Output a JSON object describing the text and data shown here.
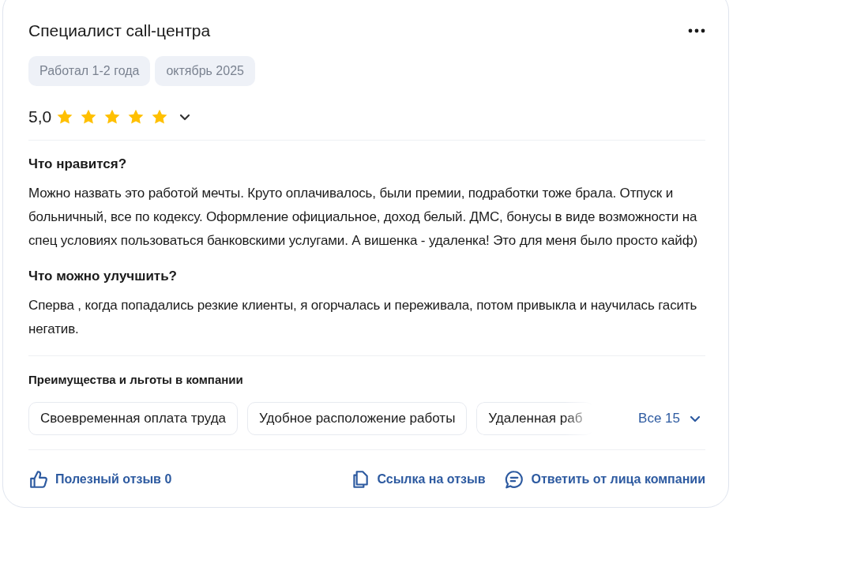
{
  "review": {
    "title": "Специалист call-центра",
    "tags": [
      "Работал 1-2 года",
      "октябрь 2025"
    ],
    "rating": {
      "score": "5,0",
      "stars": 5
    },
    "sections": [
      {
        "heading": "Что нравится?",
        "text": "Можно назвать это работой мечты. Круто оплачивалось, были премии, подработки тоже брала. Отпуск и больничный, все по кодексу. Оформление официальное, доход белый. ДМС, бонусы в виде возможности на спец условиях пользоваться банковскими услугами. А вишенка - удаленка! Это для меня было просто кайф)"
      },
      {
        "heading": "Что можно улучшить?",
        "text": "Сперва , когда попадались резкие клиенты, я огорчалась и переживала, потом привыкла и научилась гасить негатив."
      }
    ],
    "benefits": {
      "heading": "Преимущества и льготы в компании",
      "items": [
        {
          "label": "Своевременная оплата труда",
          "faded": false
        },
        {
          "label": "Удобное расположение работы",
          "faded": false
        },
        {
          "label": "Удаленная раб",
          "faded": true
        }
      ],
      "show_all": "Все 15"
    },
    "actions": [
      {
        "kind": "like",
        "label": "Полезный отзыв 0"
      },
      {
        "kind": "copy",
        "label": "Ссылка на отзыв"
      },
      {
        "kind": "reply",
        "label": "Ответить от лица компании"
      }
    ]
  }
}
